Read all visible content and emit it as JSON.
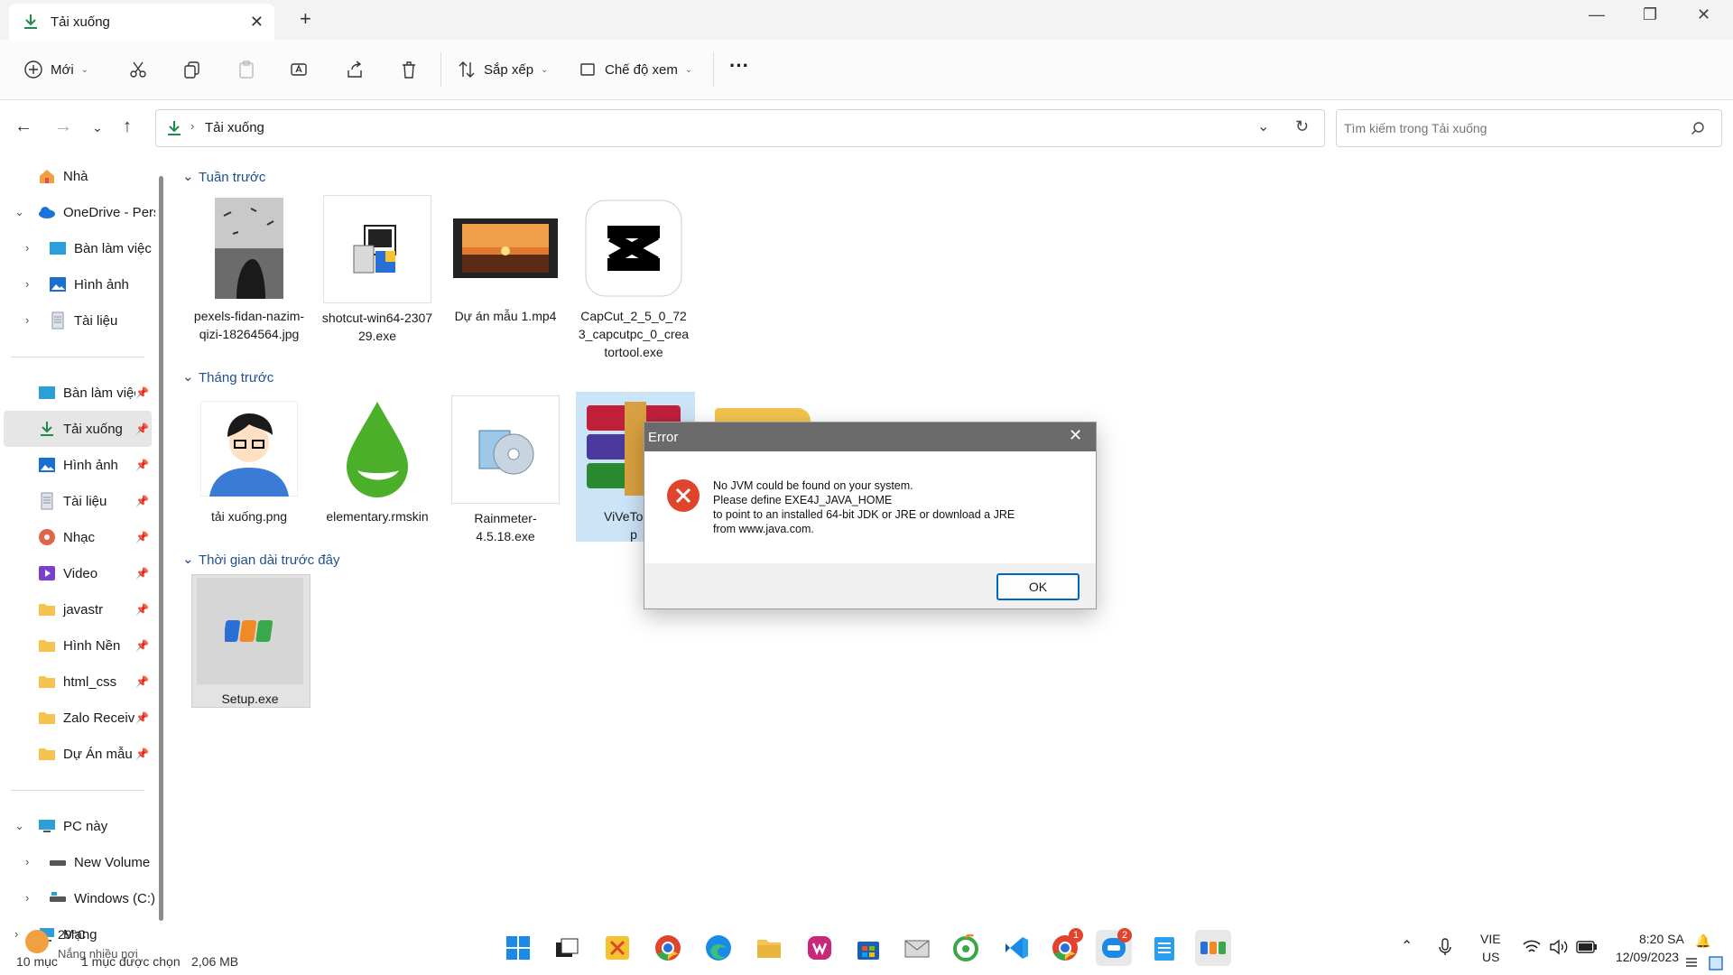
{
  "window": {
    "tab_title": "Tải xuống",
    "new_tab": "+",
    "close_tab": "✕",
    "minimize": "—",
    "maximize": "❐",
    "close": "✕"
  },
  "toolbar": {
    "new_label": "Mới",
    "sort_label": "Sắp xếp",
    "view_label": "Chế độ xem",
    "more_label": "···"
  },
  "address": {
    "crumb": "Tải xuống",
    "search_placeholder": "Tìm kiếm trong Tải xuống"
  },
  "nav": {
    "home": "Nhà",
    "onedrive": "OneDrive - Pers",
    "od_desktop": "Bàn làm việc",
    "od_pictures": "Hình ảnh",
    "od_documents": "Tài liệu",
    "qa_desktop": "Bàn làm việc",
    "qa_downloads": "Tải xuống",
    "qa_pictures": "Hình ảnh",
    "qa_documents": "Tài liệu",
    "qa_music": "Nhạc",
    "qa_video": "Video",
    "qa_javastr": "javastr",
    "qa_wallpaper": "Hình Nền",
    "qa_html": "html_css",
    "qa_zalo": "Zalo Receive",
    "qa_project": "Dự Án mẫu",
    "pc": "PC này",
    "new_volume": "New Volume (",
    "windows_c": "Windows (C:)",
    "network": "Mạng"
  },
  "groups": {
    "last_week": "Tuần trước",
    "last_month": "Tháng trước",
    "long_ago": "Thời gian dài trước đây"
  },
  "files": {
    "f1": "pexels-fidan-nazim-qizi-18264564.jpg",
    "f2": "shotcut-win64-230729.exe",
    "f3": "Dự án mẫu 1.mp4",
    "f4": "CapCut_2_5_0_723_capcutpc_0_creatortool.exe",
    "f5": "tải xuống.png",
    "f6": "elementary.rmskin",
    "f7": "Rainmeter-4.5.18.exe",
    "f8": "ViVeTool-v",
    "f8b": "p",
    "f9": "Setup.exe"
  },
  "dialog": {
    "title": "Error",
    "line1": "No JVM could be found on your system.",
    "line2": "Please define EXE4J_JAVA_HOME",
    "line3": "to point to an installed 64-bit JDK or JRE or download a JRE",
    "line4": "from www.java.com.",
    "ok": "OK"
  },
  "status": {
    "count": "10 mục",
    "selected": "1 mục được chọn",
    "size": "2,06 MB",
    "weather_temp": "29°C",
    "weather_desc": "Nắng nhiều nơi"
  },
  "taskbar": {
    "lang_top": "VIE",
    "lang_bottom": "US",
    "time": "8:20 SA",
    "date": "12/09/2023",
    "zalo_badge": "2",
    "chrome_badge": "1"
  },
  "colors": {
    "accent": "#0067c0",
    "group_header": "#1f4f8f",
    "error_red": "#e0442c",
    "selected_bg": "#cce4f7"
  }
}
